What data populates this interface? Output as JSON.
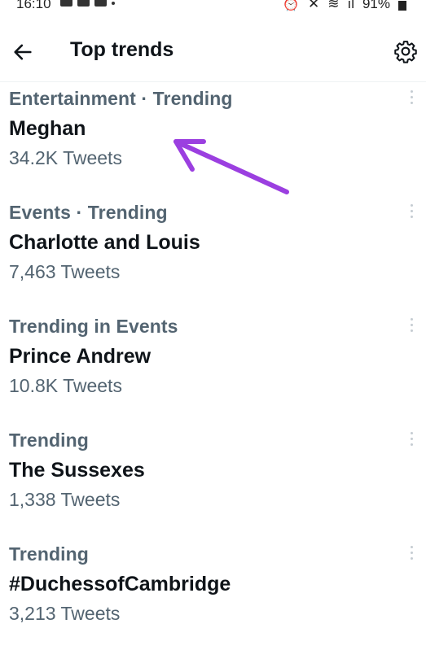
{
  "status_bar": {
    "time": "16:10",
    "battery": "91%"
  },
  "header": {
    "title": "Top trends"
  },
  "trends": [
    {
      "meta": "Entertainment · Trending",
      "name": "Meghan",
      "count": "34.2K Tweets"
    },
    {
      "meta": "Events · Trending",
      "name": "Charlotte and Louis",
      "count": "7,463 Tweets"
    },
    {
      "meta": "Trending in Events",
      "name": "Prince Andrew",
      "count": "10.8K Tweets"
    },
    {
      "meta": "Trending",
      "name": "The Sussexes",
      "count": "1,338 Tweets"
    },
    {
      "meta": "Trending",
      "name": "#DuchessofCambridge",
      "count": "3,213 Tweets"
    }
  ],
  "colors": {
    "annotation_arrow": "#9b3fe0",
    "secondary_text": "#536471",
    "primary_text": "#0f1419"
  },
  "icons": [
    "back-arrow-icon",
    "gear-icon",
    "more-vertical-icon"
  ]
}
